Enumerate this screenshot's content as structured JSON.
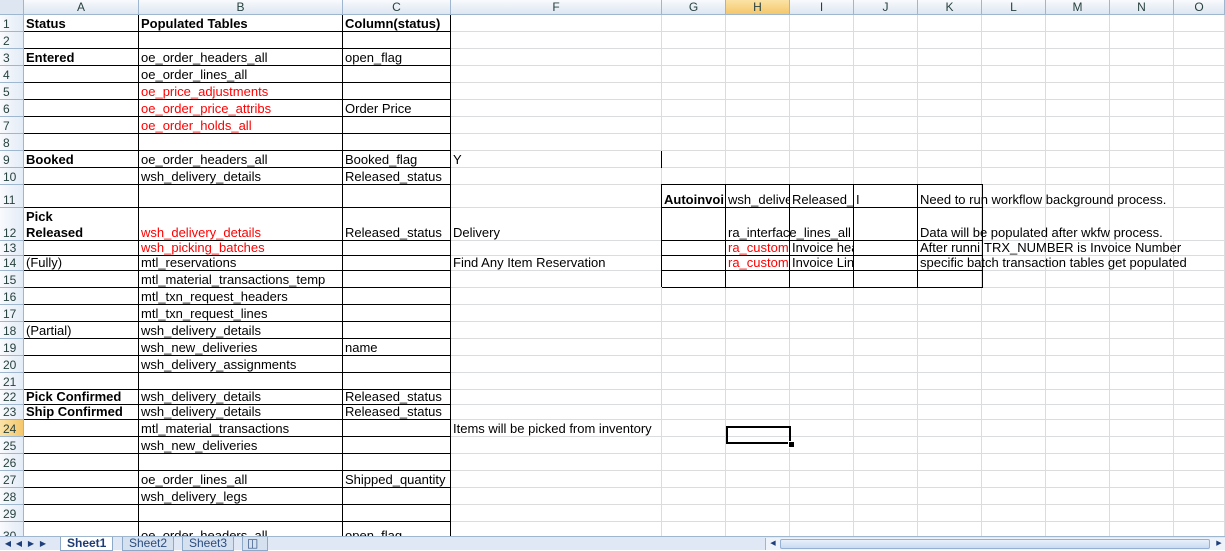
{
  "columns": [
    "A",
    "B",
    "C",
    "F",
    "G",
    "H",
    "I",
    "J",
    "K",
    "L",
    "M",
    "N",
    "O"
  ],
  "selected_column": "H",
  "rows": [
    "1",
    "2",
    "3",
    "4",
    "5",
    "6",
    "7",
    "8",
    "9",
    "10",
    "11",
    "12",
    "13",
    "14",
    "15",
    "16",
    "17",
    "18",
    "19",
    "20",
    "21",
    "22",
    "23",
    "24",
    "25",
    "26",
    "27",
    "28",
    "29",
    "30"
  ],
  "selected_row": "24",
  "cells": {
    "A1": "Status",
    "B1": "Populated Tables",
    "C1": "Column(status)",
    "A3": "Entered",
    "B3": "oe_order_headers_all",
    "C3": "open_flag",
    "B4": "oe_order_lines_all",
    "B5": "oe_price_adjustments",
    "B6": "oe_order_price_attribs",
    "C6": "Order Price",
    "B7": "oe_order_holds_all",
    "A9": "Booked",
    "B9": "oe_order_headers_all",
    "C9": "Booked_flag",
    "F9": "Y",
    "B10": "wsh_delivery_details",
    "C10": "Released_status",
    "G11": "Autoinvoi",
    "H11": "wsh_delive",
    "I11": "Released_",
    "J11": "I",
    "K11": "Need to run workflow background process.",
    "A12_line1": "Pick",
    "A12_line2": "Released",
    "B12": "wsh_delivery_details",
    "C12": "Released_status",
    "F12": "Delivery",
    "H12": "ra_interface_lines_all",
    "K12": "Data will be populated after wkfw process.",
    "B13": "wsh_picking_batches",
    "H13": "ra_custom",
    "I13": "Invoice header",
    "K13": "After runni",
    "L13": "TRX_NUMBER is Invoice Number",
    "A14": "(Fully)",
    "B14": "mtl_reservations",
    "F14": "Find Any Item Reservation",
    "H14": "ra_custom",
    "I14": "Invoice Line",
    "K14": "specific batch transaction tables get populated",
    "B15": "mtl_material_transactions_temp",
    "B16": "mtl_txn_request_headers",
    "B17": "mtl_txn_request_lines",
    "A18": "(Partial)",
    "B18": "wsh_delivery_details",
    "B19": "wsh_new_deliveries",
    "C19": "name",
    "B20": "wsh_delivery_assignments",
    "A22": "Pick Confirmed",
    "B22": "wsh_delivery_details",
    "C22": "Released_status",
    "A23": "Ship Confirmed",
    "B23": "wsh_delivery_details",
    "C23": "Released_status",
    "B24": "mtl_material_transactions",
    "F24": "Items will be picked from inventory",
    "B25": "wsh_new_deliveries",
    "B27": "oe_order_lines_all",
    "C27": "Shipped_quantity",
    "B28": "wsh_delivery_legs",
    "B30": "oe_order_headers_all",
    "C30": "open_flag"
  },
  "sheet_tabs": [
    "Sheet1",
    "Sheet2",
    "Sheet3"
  ],
  "active_tab": "Sheet1",
  "colors": {
    "red_text": "#ff0000",
    "header_bg": "#dde6f1",
    "selected_header": "#f4c76b"
  }
}
